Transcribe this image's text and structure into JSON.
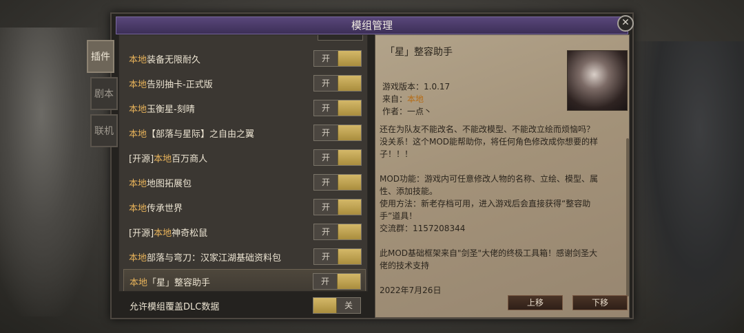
{
  "dialog": {
    "title": "模组管理",
    "close_glyph": "✕"
  },
  "side_tabs": {
    "plugin": "插件",
    "script": "剧本",
    "online": "联机"
  },
  "mods": [
    {
      "prefix": "",
      "source": "本地",
      "name": "装备无限耐久",
      "toggle": "开"
    },
    {
      "prefix": "",
      "source": "本地",
      "name": "告别抽卡-正式版",
      "toggle": "开"
    },
    {
      "prefix": "",
      "source": "本地",
      "name": "玉衡星-刻晴",
      "toggle": "开"
    },
    {
      "prefix": "",
      "source": "本地",
      "name": "【部落与星际】之自由之翼",
      "toggle": "开"
    },
    {
      "prefix": "[开源]",
      "source": "本地",
      "name": "百万商人",
      "toggle": "开"
    },
    {
      "prefix": "",
      "source": "本地",
      "name": "地图拓展包",
      "toggle": "开"
    },
    {
      "prefix": "",
      "source": "本地",
      "name": "传承世界",
      "toggle": "开"
    },
    {
      "prefix": "[开源]",
      "source": "本地",
      "name": "神奇松鼠",
      "toggle": "开"
    },
    {
      "prefix": "",
      "source": "本地",
      "name": "部落与弯刀：汉家江湖基础资料包",
      "toggle": "开"
    },
    {
      "prefix": "",
      "source": "本地",
      "name": "「星」整容助手",
      "toggle": "开"
    }
  ],
  "bottom": {
    "label": "允许模组覆盖DLC数据",
    "toggle": "关"
  },
  "detail": {
    "title": "「星」整容助手",
    "version": "游戏版本：1.0.17",
    "from_label": "来自：",
    "from_value": "本地",
    "author": "作者：一点丶",
    "desc_lines": [
      "还在为队友不能改名、不能改模型、不能改立绘而烦恼吗？",
      "没关系！这个MOD能帮助你，将任何角色修改成你想要的样",
      "子！！！",
      "",
      "MOD功能：游戏内可任意修改人物的名称、立绘、模型、属",
      "性、添加技能。",
      "使用方法：新老存档可用，进入游戏后会直接获得“整容助",
      "手”道具！",
      "交流群：1157208344",
      "",
      "此MOD基础框架来自\"剑圣\"大佬的终极工具箱！感谢剑圣大",
      "佬的技术支持",
      "",
      "2022年7月26日"
    ],
    "move_up": "上移",
    "move_down": "下移"
  },
  "colors": {
    "accent": "#e8b35a",
    "title_bar": "#4a3b69",
    "knob": "#c9ad5a"
  }
}
